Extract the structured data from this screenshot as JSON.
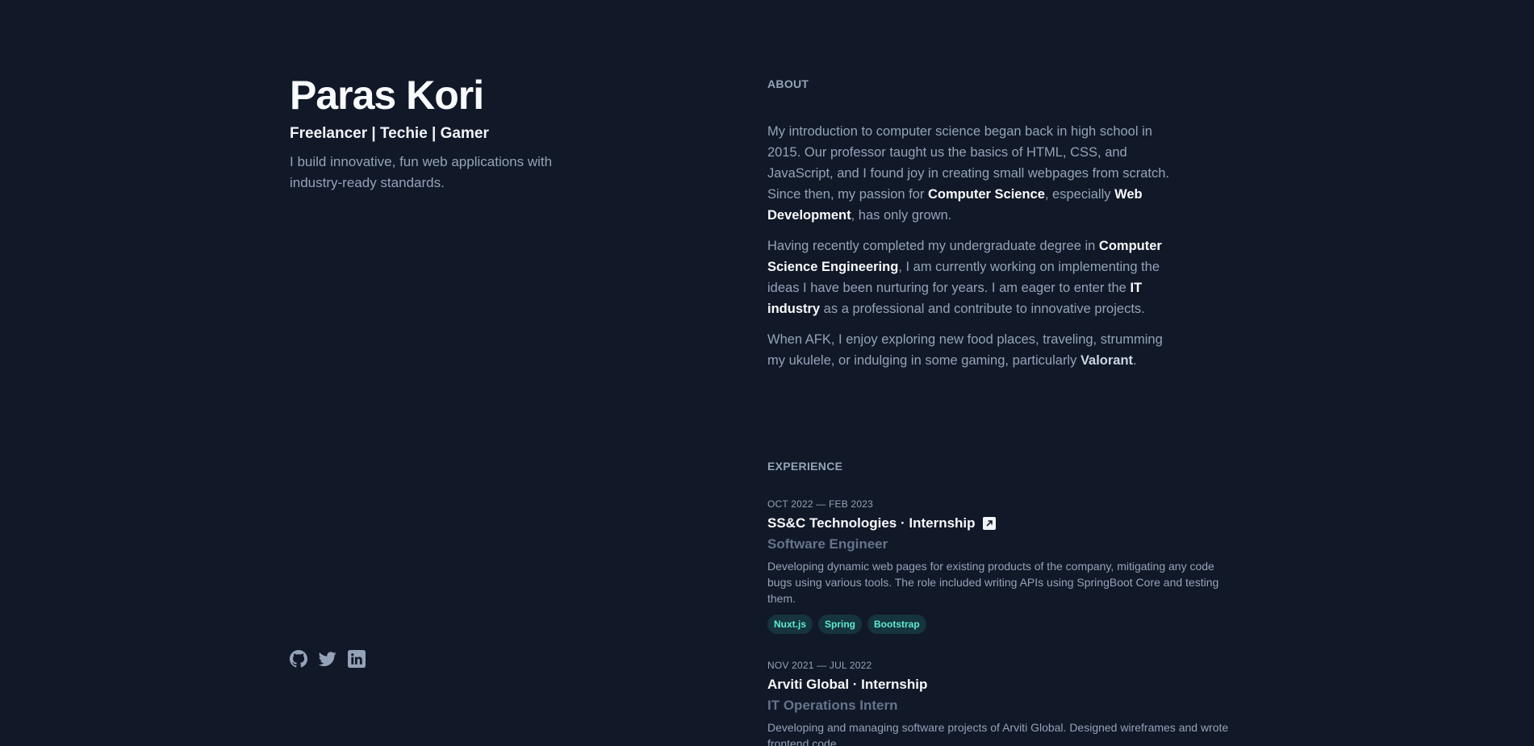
{
  "profile": {
    "name": "Paras Kori",
    "tagline": "Freelancer | Techie | Gamer",
    "intro": "I build innovative, fun web applications with industry-ready standards."
  },
  "socials": [
    {
      "icon": "github-icon"
    },
    {
      "icon": "twitter-icon"
    },
    {
      "icon": "linkedin-icon"
    }
  ],
  "about": {
    "heading": "ABOUT",
    "p1": {
      "t1": "My introduction to computer science began back in high school in 2015. Our professor taught us the basics of HTML, CSS, and JavaScript, and I found joy in creating small webpages from scratch. Since then, my passion for ",
      "b1": "Computer Science",
      "t2": ", especially ",
      "b2": "Web Development",
      "t3": ", has only grown."
    },
    "p2": {
      "t1": "Having recently completed my undergraduate degree in ",
      "b1": "Computer Science Engineering",
      "t2": ", I am currently working on implementing the ideas I have been nurturing for years. I am eager to enter the ",
      "b2": "IT industry",
      "t3": " as a professional and contribute to innovative projects."
    },
    "p3": {
      "t1": "When AFK, I enjoy exploring new food places, traveling, strumming my ukulele, or indulging in some gaming, particularly ",
      "b1": "Valorant",
      "t2": "."
    }
  },
  "experience": {
    "heading": "EXPERIENCE",
    "jobs": [
      {
        "date": "OCT 2022 — FEB 2023",
        "title": "SS&C Technologies · Internship",
        "role": "Software Engineer",
        "description": "Developing dynamic web pages for existing products of the company, mitigating any code bugs using various tools. The role included writing APIs using SpringBoot Core and testing them.",
        "tags": [
          "Nuxt.js",
          "Spring",
          "Bootstrap"
        ]
      },
      {
        "date": "NOV 2021 — JUL 2022",
        "title": "Arviti Global · Internship",
        "role": "IT Operations Intern",
        "description": "Developing and managing software projects of Arviti Global. Designed wireframes and wrote frontend code."
      }
    ]
  },
  "colors": {
    "background": "#111827",
    "heading": "#f8fafc",
    "body": "#94a3b8",
    "role": "#64748b",
    "tag_text": "#5eead4"
  }
}
